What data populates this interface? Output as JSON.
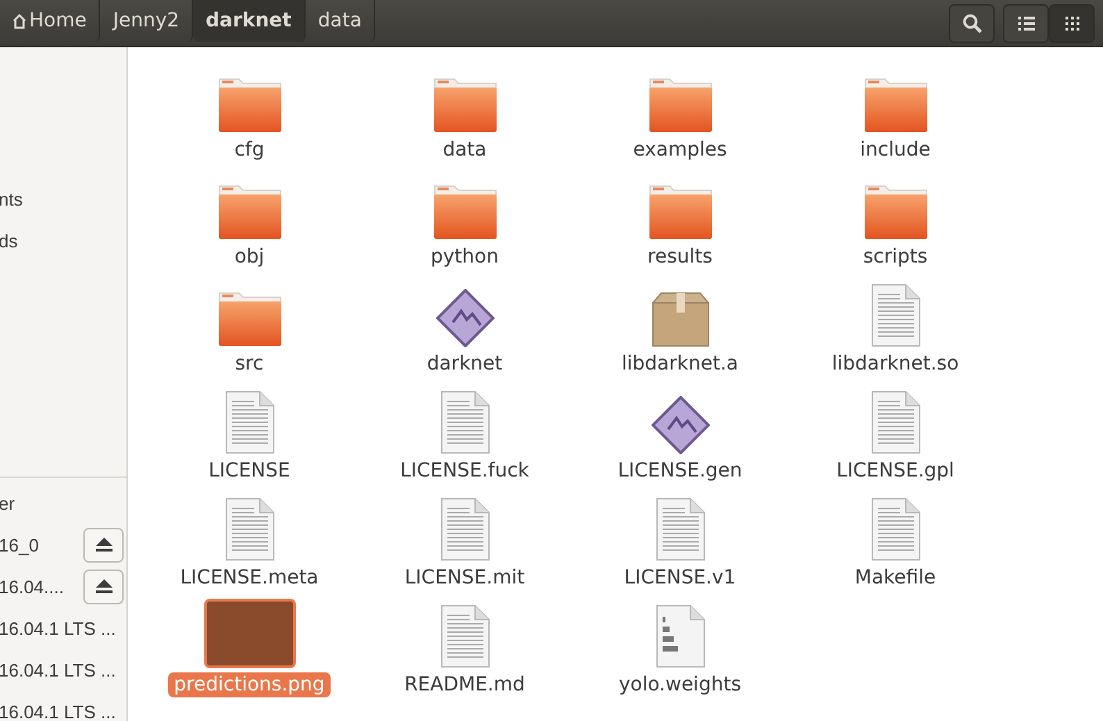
{
  "toolbar": {
    "breadcrumbs": [
      {
        "label": "Home",
        "kind": "home",
        "selected": false
      },
      {
        "label": "Jenny2",
        "kind": "folder",
        "selected": false
      },
      {
        "label": "darknet",
        "kind": "folder",
        "selected": true
      },
      {
        "label": "data",
        "kind": "folder",
        "selected": false
      }
    ],
    "view_buttons": [
      {
        "kind": "list",
        "selected": false
      },
      {
        "kind": "grid",
        "selected": true
      }
    ]
  },
  "sidebar": {
    "places": [
      {
        "label": "nts"
      },
      {
        "label": "ds"
      }
    ],
    "devices": [
      {
        "label": "er",
        "eject": false
      },
      {
        "label": "16_0",
        "eject": true
      },
      {
        "label": "16.04....",
        "eject": true
      },
      {
        "label": "16.04.1 LTS ...",
        "eject": false
      },
      {
        "label": "16.04.1 LTS ...",
        "eject": false
      },
      {
        "label": "16.04.1 LTS ...",
        "eject": false
      }
    ]
  },
  "files": [
    {
      "name": "cfg",
      "kind": "folder",
      "selected": false
    },
    {
      "name": "data",
      "kind": "folder",
      "selected": false
    },
    {
      "name": "examples",
      "kind": "folder",
      "selected": false
    },
    {
      "name": "include",
      "kind": "folder",
      "selected": false
    },
    {
      "name": "obj",
      "kind": "folder",
      "selected": false
    },
    {
      "name": "python",
      "kind": "folder",
      "selected": false
    },
    {
      "name": "results",
      "kind": "folder",
      "selected": false
    },
    {
      "name": "scripts",
      "kind": "folder",
      "selected": false
    },
    {
      "name": "src",
      "kind": "folder",
      "selected": false
    },
    {
      "name": "darknet",
      "kind": "executable",
      "selected": false
    },
    {
      "name": "libdarknet.a",
      "kind": "archive",
      "selected": false
    },
    {
      "name": "libdarknet.so",
      "kind": "text",
      "selected": false
    },
    {
      "name": "LICENSE",
      "kind": "text",
      "selected": false
    },
    {
      "name": "LICENSE.fuck",
      "kind": "text",
      "selected": false
    },
    {
      "name": "LICENSE.gen",
      "kind": "executable",
      "selected": false
    },
    {
      "name": "LICENSE.gpl",
      "kind": "text",
      "selected": false
    },
    {
      "name": "LICENSE.meta",
      "kind": "text",
      "selected": false
    },
    {
      "name": "LICENSE.mit",
      "kind": "text",
      "selected": false
    },
    {
      "name": "LICENSE.v1",
      "kind": "text",
      "selected": false
    },
    {
      "name": "Makefile",
      "kind": "text",
      "selected": false
    },
    {
      "name": "predictions.png",
      "kind": "image",
      "selected": true
    },
    {
      "name": "README.md",
      "kind": "text",
      "selected": false
    },
    {
      "name": "yolo.weights",
      "kind": "binary",
      "selected": false
    }
  ]
}
